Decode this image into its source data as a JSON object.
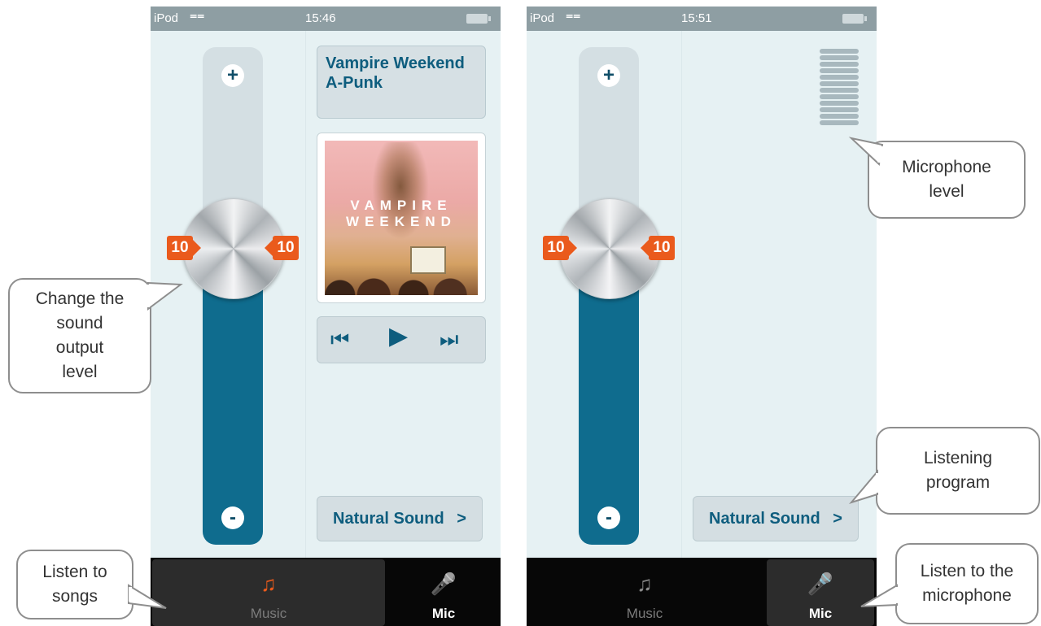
{
  "left_screen": {
    "status": {
      "carrier": "iPod",
      "time": "15:46"
    },
    "volume": {
      "plus": "+",
      "minus": "-",
      "left_value": "10",
      "right_value": "10"
    },
    "now_playing": {
      "artist": "Vampire Weekend",
      "title": "A-Punk"
    },
    "album_text": {
      "line1": "VAMPIRE",
      "line2": "WEEKEND"
    },
    "transport": {
      "prev": "⏮",
      "play": "▶",
      "next": "⏭"
    },
    "program": "Natural Sound",
    "program_chevron": ">",
    "tabs": [
      {
        "label": "Music",
        "icon": "music-note-icon",
        "glyph": "♫",
        "active": true
      },
      {
        "label": "Mic",
        "icon": "microphone-icon",
        "glyph": "🎤",
        "active": false
      }
    ]
  },
  "right_screen": {
    "status": {
      "carrier": "iPod",
      "time": "15:51"
    },
    "volume": {
      "plus": "+",
      "minus": "-",
      "left_value": "10",
      "right_value": "10"
    },
    "program": "Natural Sound",
    "program_chevron": ">",
    "tabs": [
      {
        "label": "Music",
        "icon": "music-note-icon",
        "glyph": "♫",
        "active": false
      },
      {
        "label": "Mic",
        "icon": "microphone-icon",
        "glyph": "🎤",
        "active": true
      }
    ]
  },
  "callouts": {
    "change_level": "Change the\nsound\noutput\nlevel",
    "listen_songs": "Listen to\nsongs",
    "mic_level": "Microphone\nlevel",
    "listening_program": "Listening\nprogram",
    "listen_mic": "Listen to the\nmicrophone"
  },
  "colors": {
    "accent_orange": "#ea5a1c",
    "teal": "#0f6c8e",
    "tab_active_text": "#ffffff",
    "tab_inactive_text": "#7c7c7c"
  },
  "volume_level_fraction": 0.52,
  "mic_meter_bars": 12
}
